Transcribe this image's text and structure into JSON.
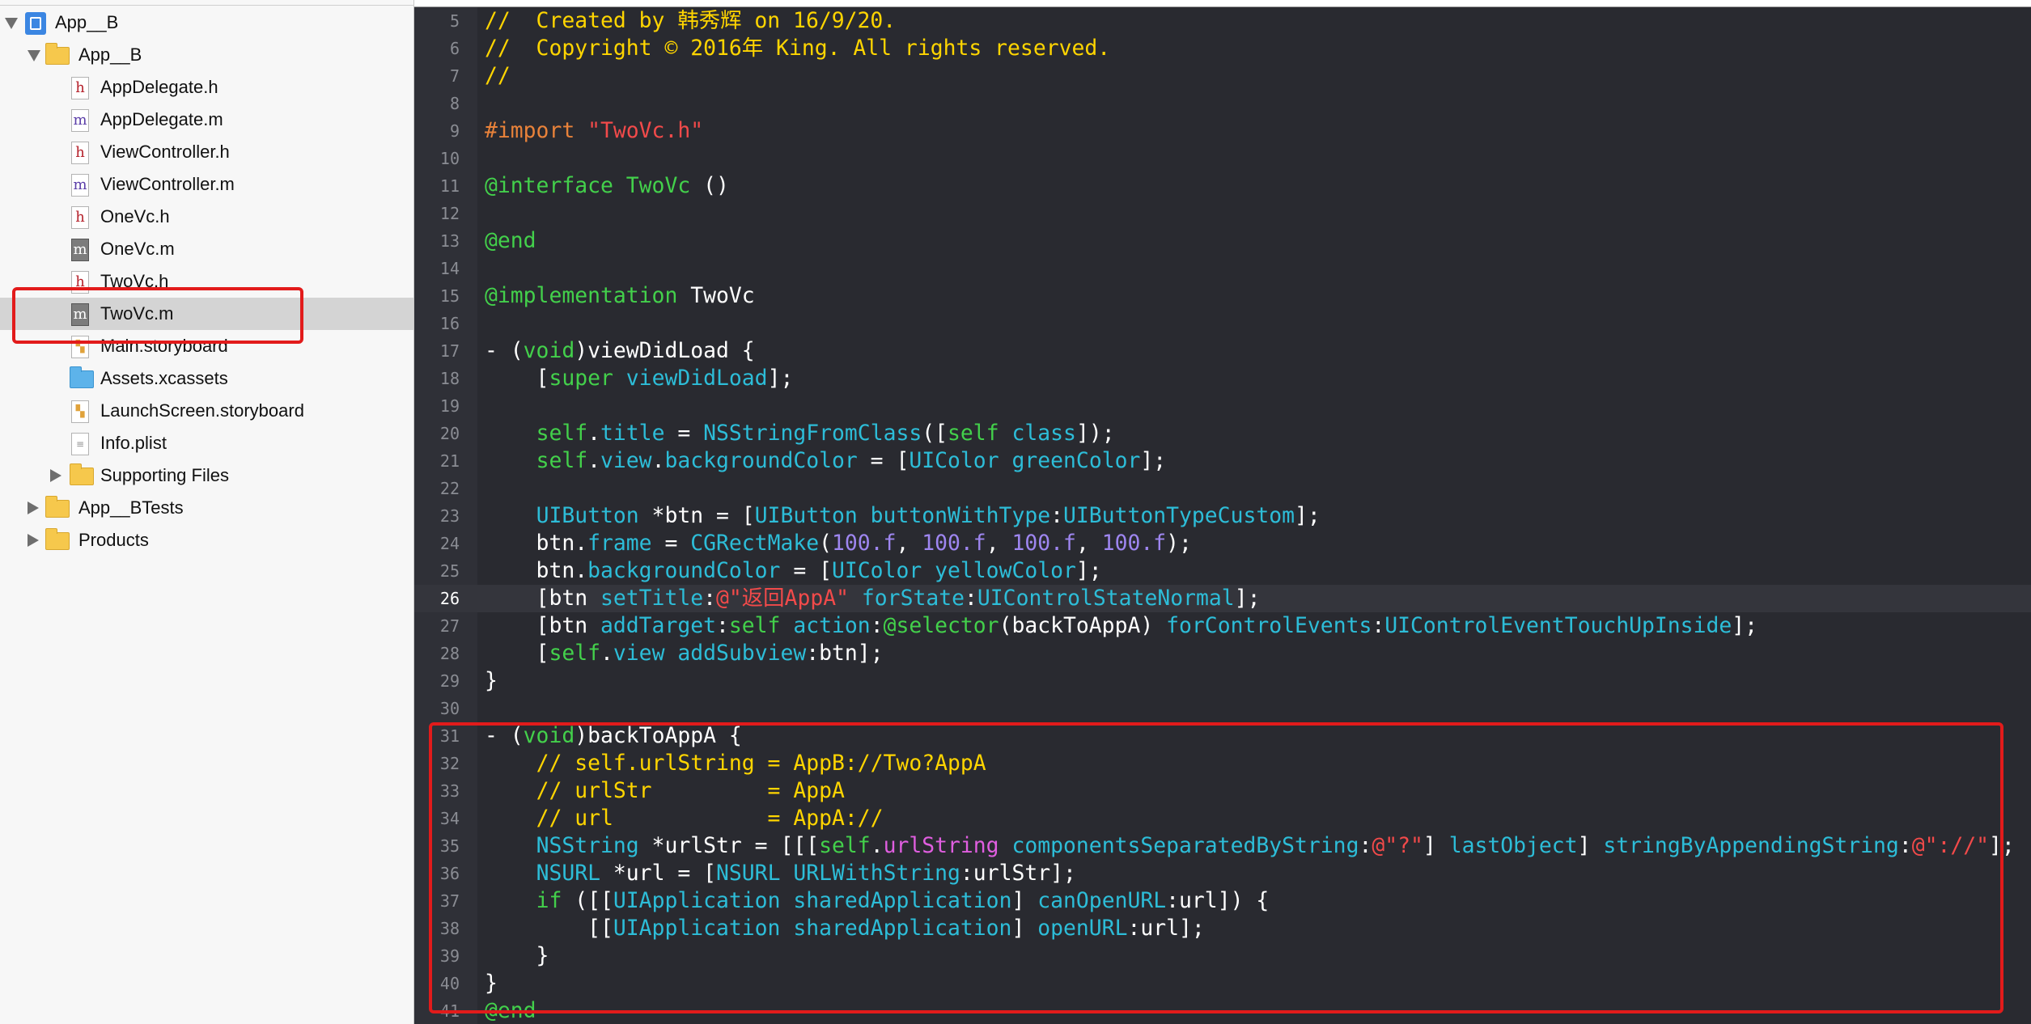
{
  "navigator": {
    "items": [
      {
        "label": "App__B",
        "icon": "project-icon",
        "disclosure": "open"
      },
      {
        "label": "App__B",
        "icon": "folder-icon",
        "disclosure": "open"
      },
      {
        "label": "AppDelegate.h",
        "icon": "header-file-icon",
        "badge": "h"
      },
      {
        "label": "AppDelegate.m",
        "icon": "objc-file-icon",
        "badge": "m"
      },
      {
        "label": "ViewController.h",
        "icon": "header-file-icon",
        "badge": "h"
      },
      {
        "label": "ViewController.m",
        "icon": "objc-file-icon",
        "badge": "m"
      },
      {
        "label": "OneVc.h",
        "icon": "header-file-icon",
        "badge": "h"
      },
      {
        "label": "OneVc.m",
        "icon": "objc-file-icon",
        "badge": "m"
      },
      {
        "label": "TwoVc.h",
        "icon": "header-file-icon",
        "badge": "h"
      },
      {
        "label": "TwoVc.m",
        "icon": "objc-file-icon",
        "badge": "m",
        "selected": true
      },
      {
        "label": "Main.storyboard",
        "icon": "storyboard-icon"
      },
      {
        "label": "Assets.xcassets",
        "icon": "asset-catalog-icon"
      },
      {
        "label": "LaunchScreen.storyboard",
        "icon": "storyboard-icon"
      },
      {
        "label": "Info.plist",
        "icon": "plist-icon"
      },
      {
        "label": "Supporting Files",
        "icon": "folder-icon",
        "disclosure": "closed"
      },
      {
        "label": "App__BTests",
        "icon": "folder-icon",
        "disclosure": "closed"
      },
      {
        "label": "Products",
        "icon": "folder-icon",
        "disclosure": "closed"
      }
    ]
  },
  "editor": {
    "current_line": 26,
    "lines": [
      {
        "n": "5",
        "t": [
          [
            "cmt",
            "//  Created by 韩秀辉 on 16/9/20."
          ]
        ]
      },
      {
        "n": "6",
        "t": [
          [
            "cmt",
            "//  Copyright © 2016年 King. All rights reserved."
          ]
        ]
      },
      {
        "n": "7",
        "t": [
          [
            "cmt",
            "//"
          ]
        ]
      },
      {
        "n": "8",
        "t": []
      },
      {
        "n": "9",
        "t": [
          [
            "pre",
            "#import "
          ],
          [
            "str",
            "\"TwoVc.h\""
          ]
        ]
      },
      {
        "n": "10",
        "t": []
      },
      {
        "n": "11",
        "t": [
          [
            "key",
            "@interface"
          ],
          [
            "pl",
            " "
          ],
          [
            "key",
            "TwoVc"
          ],
          [
            "pl",
            " ()"
          ]
        ]
      },
      {
        "n": "12",
        "t": []
      },
      {
        "n": "13",
        "t": [
          [
            "key",
            "@end"
          ]
        ]
      },
      {
        "n": "14",
        "t": []
      },
      {
        "n": "15",
        "t": [
          [
            "key",
            "@implementation"
          ],
          [
            "pl",
            " TwoVc"
          ]
        ]
      },
      {
        "n": "16",
        "t": []
      },
      {
        "n": "17",
        "t": [
          [
            "pl",
            "- ("
          ],
          [
            "key",
            "void"
          ],
          [
            "pl",
            ")viewDidLoad {"
          ]
        ]
      },
      {
        "n": "18",
        "t": [
          [
            "pl",
            "    ["
          ],
          [
            "key",
            "super"
          ],
          [
            "pl",
            " "
          ],
          [
            "fn",
            "viewDidLoad"
          ],
          [
            "pl",
            "];"
          ]
        ]
      },
      {
        "n": "19",
        "t": []
      },
      {
        "n": "20",
        "t": [
          [
            "pl",
            "    "
          ],
          [
            "key",
            "self"
          ],
          [
            "pl",
            "."
          ],
          [
            "fn",
            "title"
          ],
          [
            "pl",
            " = "
          ],
          [
            "fn",
            "NSStringFromClass"
          ],
          [
            "pl",
            "(["
          ],
          [
            "key",
            "self"
          ],
          [
            "pl",
            " "
          ],
          [
            "fn",
            "class"
          ],
          [
            "pl",
            "]);"
          ]
        ]
      },
      {
        "n": "21",
        "t": [
          [
            "pl",
            "    "
          ],
          [
            "key",
            "self"
          ],
          [
            "pl",
            "."
          ],
          [
            "fn",
            "view"
          ],
          [
            "pl",
            "."
          ],
          [
            "fn",
            "backgroundColor"
          ],
          [
            "pl",
            " = ["
          ],
          [
            "fn",
            "UIColor"
          ],
          [
            "pl",
            " "
          ],
          [
            "fn",
            "greenColor"
          ],
          [
            "pl",
            "];"
          ]
        ]
      },
      {
        "n": "22",
        "t": []
      },
      {
        "n": "23",
        "t": [
          [
            "pl",
            "    "
          ],
          [
            "fn",
            "UIButton"
          ],
          [
            "pl",
            " *btn = ["
          ],
          [
            "fn",
            "UIButton"
          ],
          [
            "pl",
            " "
          ],
          [
            "fn",
            "buttonWithType"
          ],
          [
            "pl",
            ":"
          ],
          [
            "fn",
            "UIButtonTypeCustom"
          ],
          [
            "pl",
            "];"
          ]
        ]
      },
      {
        "n": "24",
        "t": [
          [
            "pl",
            "    btn."
          ],
          [
            "fn",
            "frame"
          ],
          [
            "pl",
            " = "
          ],
          [
            "fn",
            "CGRectMake"
          ],
          [
            "pl",
            "("
          ],
          [
            "num",
            "100.f"
          ],
          [
            "pl",
            ", "
          ],
          [
            "num",
            "100.f"
          ],
          [
            "pl",
            ", "
          ],
          [
            "num",
            "100.f"
          ],
          [
            "pl",
            ", "
          ],
          [
            "num",
            "100.f"
          ],
          [
            "pl",
            ");"
          ]
        ]
      },
      {
        "n": "25",
        "t": [
          [
            "pl",
            "    btn."
          ],
          [
            "fn",
            "backgroundColor"
          ],
          [
            "pl",
            " = ["
          ],
          [
            "fn",
            "UIColor"
          ],
          [
            "pl",
            " "
          ],
          [
            "fn",
            "yellowColor"
          ],
          [
            "pl",
            "];"
          ]
        ]
      },
      {
        "n": "26",
        "t": [
          [
            "pl",
            "    [btn "
          ],
          [
            "fn",
            "setTitle"
          ],
          [
            "pl",
            ":"
          ],
          [
            "str",
            "@\"返回AppA\""
          ],
          [
            "pl",
            " "
          ],
          [
            "fn",
            "forState"
          ],
          [
            "pl",
            ":"
          ],
          [
            "fn",
            "UIControlStateNormal"
          ],
          [
            "pl",
            "];"
          ]
        ]
      },
      {
        "n": "27",
        "t": [
          [
            "pl",
            "    [btn "
          ],
          [
            "fn",
            "addTarget"
          ],
          [
            "pl",
            ":"
          ],
          [
            "key",
            "self"
          ],
          [
            "pl",
            " "
          ],
          [
            "fn",
            "action"
          ],
          [
            "pl",
            ":"
          ],
          [
            "key",
            "@selector"
          ],
          [
            "pl",
            "(backToAppA) "
          ],
          [
            "fn",
            "forControlEvents"
          ],
          [
            "pl",
            ":"
          ],
          [
            "fn",
            "UIControlEventTouchUpInside"
          ],
          [
            "pl",
            "];"
          ]
        ]
      },
      {
        "n": "28",
        "t": [
          [
            "pl",
            "    ["
          ],
          [
            "key",
            "self"
          ],
          [
            "pl",
            "."
          ],
          [
            "fn",
            "view"
          ],
          [
            "pl",
            " "
          ],
          [
            "fn",
            "addSubview"
          ],
          [
            "pl",
            ":btn];"
          ]
        ]
      },
      {
        "n": "29",
        "t": [
          [
            "pl",
            "}"
          ]
        ]
      },
      {
        "n": "30",
        "t": []
      },
      {
        "n": "31",
        "t": [
          [
            "pl",
            "- ("
          ],
          [
            "key",
            "void"
          ],
          [
            "pl",
            ")backToAppA {"
          ]
        ]
      },
      {
        "n": "32",
        "t": [
          [
            "pl",
            "    "
          ],
          [
            "cmt",
            "// self.urlString = AppB://Two?AppA"
          ]
        ]
      },
      {
        "n": "33",
        "t": [
          [
            "pl",
            "    "
          ],
          [
            "cmt",
            "// urlStr         = AppA"
          ]
        ]
      },
      {
        "n": "34",
        "t": [
          [
            "pl",
            "    "
          ],
          [
            "cmt",
            "// url            = AppA://"
          ]
        ]
      },
      {
        "n": "35",
        "t": [
          [
            "pl",
            "    "
          ],
          [
            "fn",
            "NSString"
          ],
          [
            "pl",
            " *urlStr = [[["
          ],
          [
            "key",
            "self"
          ],
          [
            "pl",
            "."
          ],
          [
            "prop",
            "urlString"
          ],
          [
            "pl",
            " "
          ],
          [
            "fn",
            "componentsSeparatedByString"
          ],
          [
            "pl",
            ":"
          ],
          [
            "str",
            "@\"?\""
          ],
          [
            "pl",
            "] "
          ],
          [
            "fn",
            "lastObject"
          ],
          [
            "pl",
            "] "
          ],
          [
            "fn",
            "stringByAppendingString"
          ],
          [
            "pl",
            ":"
          ],
          [
            "str",
            "@\"://\""
          ],
          [
            "pl",
            "];"
          ]
        ]
      },
      {
        "n": "36",
        "t": [
          [
            "pl",
            "    "
          ],
          [
            "fn",
            "NSURL"
          ],
          [
            "pl",
            " *url = ["
          ],
          [
            "fn",
            "NSURL"
          ],
          [
            "pl",
            " "
          ],
          [
            "fn",
            "URLWithString"
          ],
          [
            "pl",
            ":urlStr];"
          ]
        ]
      },
      {
        "n": "37",
        "t": [
          [
            "pl",
            "    "
          ],
          [
            "key",
            "if"
          ],
          [
            "pl",
            " ([["
          ],
          [
            "fn",
            "UIApplication"
          ],
          [
            "pl",
            " "
          ],
          [
            "fn",
            "sharedApplication"
          ],
          [
            "pl",
            "] "
          ],
          [
            "fn",
            "canOpenURL"
          ],
          [
            "pl",
            ":url]) {"
          ]
        ]
      },
      {
        "n": "38",
        "t": [
          [
            "pl",
            "        [["
          ],
          [
            "fn",
            "UIApplication"
          ],
          [
            "pl",
            " "
          ],
          [
            "fn",
            "sharedApplication"
          ],
          [
            "pl",
            "] "
          ],
          [
            "fn",
            "openURL"
          ],
          [
            "pl",
            ":url];"
          ]
        ]
      },
      {
        "n": "39",
        "t": [
          [
            "pl",
            "    }"
          ]
        ]
      },
      {
        "n": "40",
        "t": [
          [
            "pl",
            "}"
          ]
        ]
      },
      {
        "n": "41",
        "t": [
          [
            "key",
            "@end"
          ]
        ]
      }
    ]
  },
  "colors": {
    "editor_background": "#292a30",
    "comment": "#ffd500",
    "preprocessor": "#e8823a",
    "string": "#f24a4a",
    "keyword": "#43d04b",
    "identifier": "#2dbdd8",
    "number": "#9e86f0",
    "property": "#e05ee0",
    "annotation_box": "#e21b1b"
  }
}
